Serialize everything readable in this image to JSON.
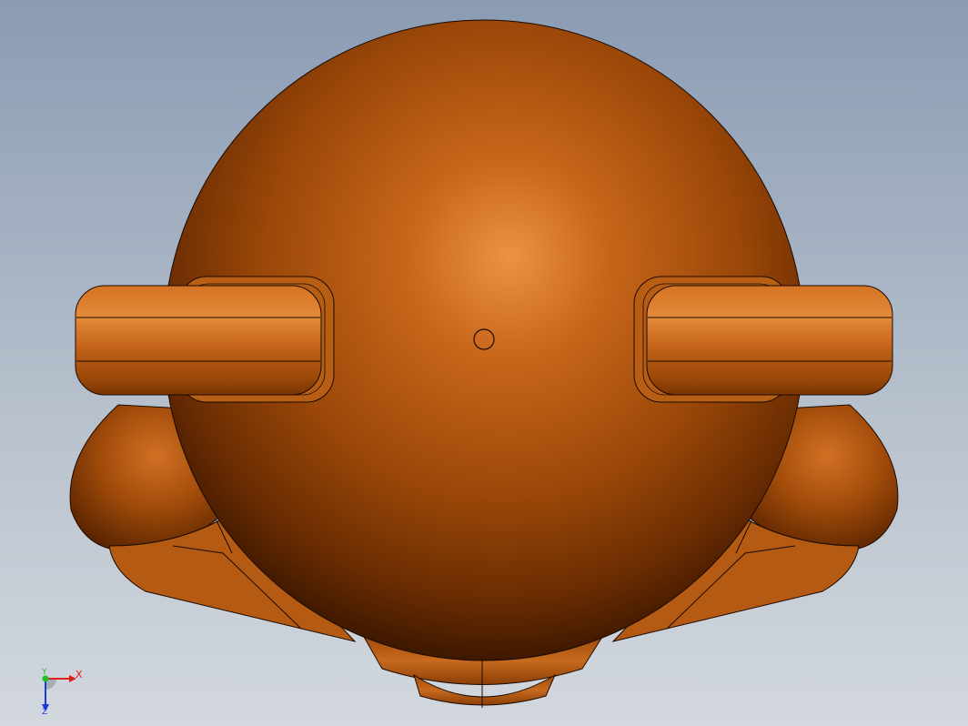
{
  "viewport": {
    "background_top": "#8a9bb3",
    "background_bottom": "#d3d8de"
  },
  "model": {
    "part_color": "#b85a0e",
    "highlight_color": "#e8903f",
    "shadow_color": "#3a1600",
    "edge_color": "#1a0a00",
    "icon": "cad-model-shaded"
  },
  "triad": {
    "x_label": "X",
    "y_label": "Y",
    "z_label": "Z",
    "x_color": "#e0201a",
    "y_color": "#1ec01e",
    "z_color": "#1a3ae0"
  }
}
